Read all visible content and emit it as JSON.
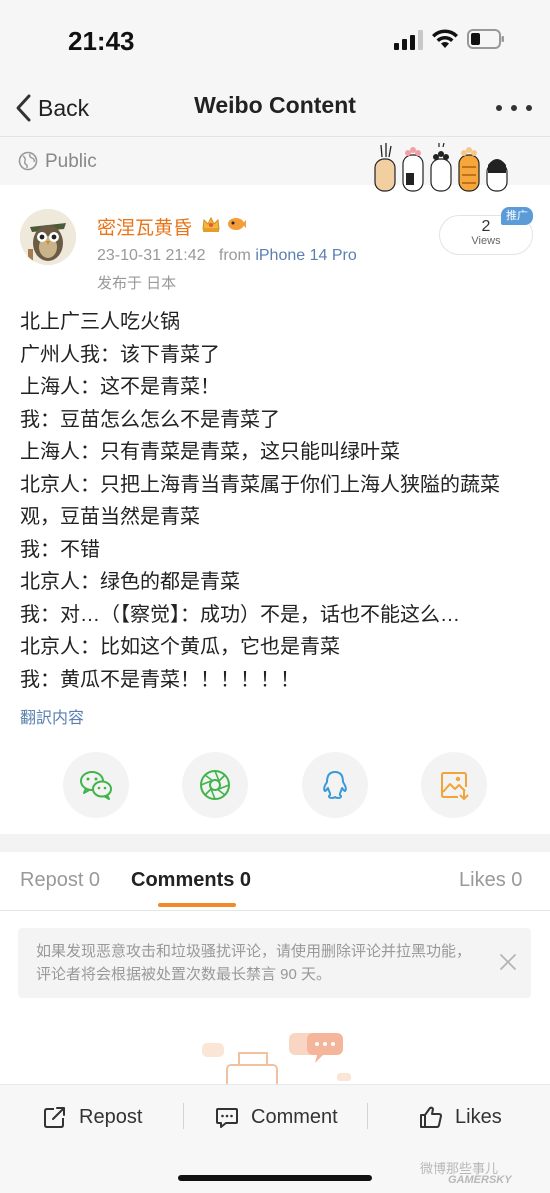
{
  "status_bar": {
    "time": "21:43"
  },
  "navbar": {
    "back_label": "Back",
    "title": "Weibo Content"
  },
  "visibility": {
    "label": "Public"
  },
  "post": {
    "username": "密涅瓦黄昏",
    "timestamp": "23-10-31 21:42",
    "source_prefix": "from",
    "source": "iPhone 14 Pro",
    "location": "发布于 日本",
    "views_count": "2",
    "views_label": "Views",
    "promo_badge": "推广",
    "lines": [
      "北上广三人吃火锅",
      "广州人我：该下青菜了",
      "上海人：这不是青菜！",
      "我：豆苗怎么怎么不是青菜了",
      "上海人：只有青菜是青菜，这只能叫绿叶菜",
      "北京人：只把上海青当青菜属于你们上海人狭隘的蔬菜",
      "观，豆苗当然是青菜",
      "我：不错",
      "北京人：绿色的都是青菜",
      "我：对…（【察觉】：成功）不是，话也不能这么…",
      "北京人：比如这个黄瓜，它也是青菜",
      "我：黄瓜不是青菜！！！！！！"
    ],
    "translate_label": "翻訳内容"
  },
  "share": {
    "icons": [
      "wechat-icon",
      "moments-icon",
      "qq-icon",
      "save-image-icon"
    ],
    "colors": {
      "wechat": "#3fb549",
      "moments": "#3fb549",
      "qq": "#3a9ad9",
      "save": "#f0a43a"
    }
  },
  "tabs": {
    "repost": "Repost 0",
    "comments": "Comments 0",
    "likes": "Likes 0"
  },
  "notice": {
    "text": "如果发现恶意攻击和垃圾骚扰评论，请使用删除评论并拉黑功能，评论者将会根据被处置次数最长禁言 90 天。"
  },
  "bottom_bar": {
    "repost": "Repost",
    "comment": "Comment",
    "likes": "Likes"
  },
  "watermark": {
    "line1": "微博那些事儿",
    "line2": "GAMERSKY"
  },
  "colors": {
    "accent": "#f08a2b",
    "username": "#e8751a",
    "link": "#5b7fb0"
  }
}
